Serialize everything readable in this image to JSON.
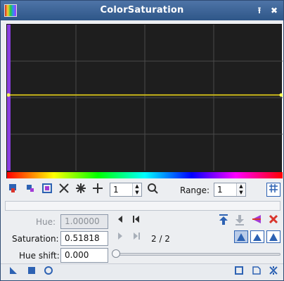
{
  "window": {
    "title": "ColorSaturation"
  },
  "titlebar_icons": [
    "app-icon",
    "shade-icon",
    "close-icon"
  ],
  "toolbar": {
    "zoom_value": "1",
    "range_label": "Range:",
    "range_value": "1"
  },
  "controls": {
    "hue_label": "Hue:",
    "hue_value": "1.00000",
    "saturation_label": "Saturation:",
    "saturation_value": "0.51818",
    "point_counter": "2 / 2",
    "hue_shift_label": "Hue shift:",
    "hue_shift_value": "0.000"
  },
  "curve": {
    "line_color": "#c8b51a",
    "grid_color": "#4a4a4a",
    "background": "#1e1e1e",
    "points": [
      {
        "hue": 0.0,
        "saturation": 0.51818
      },
      {
        "hue": 1.0,
        "saturation": 0.51818
      }
    ]
  },
  "colors": {
    "accent": "#2d62b3",
    "titlebar": "#3a6399",
    "delete_red": "#d9342b"
  }
}
